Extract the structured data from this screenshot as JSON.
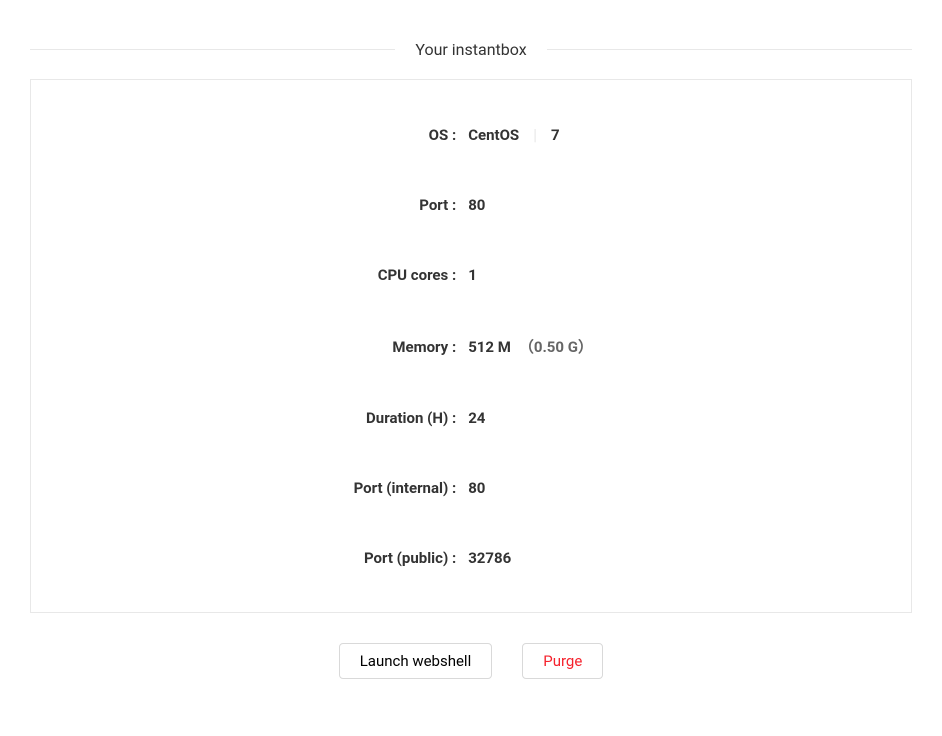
{
  "title": "Your instantbox",
  "details": {
    "os": {
      "label": "OS :",
      "name": "CentOS",
      "version": "7"
    },
    "port": {
      "label": "Port :",
      "value": "80"
    },
    "cpu": {
      "label": "CPU cores :",
      "value": "1"
    },
    "memory": {
      "label": "Memory :",
      "value": "512 M",
      "note": "（0.50 G）"
    },
    "duration": {
      "label": "Duration (H) :",
      "value": "24"
    },
    "port_internal": {
      "label": "Port (internal) :",
      "value": "80"
    },
    "port_public": {
      "label": "Port (public) :",
      "value": "32786"
    }
  },
  "buttons": {
    "launch": "Launch webshell",
    "purge": "Purge"
  }
}
